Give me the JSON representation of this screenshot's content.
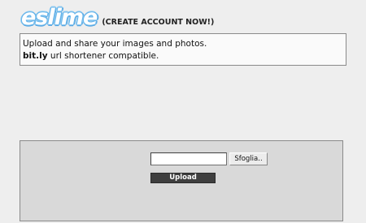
{
  "header": {
    "logo_text": "eslime",
    "cta_label": "(CREATE ACCOUNT NOW!)"
  },
  "info": {
    "line1": "Upload and share your images and photos.",
    "line2_bold": "bit.ly",
    "line2_rest": " url shortener compatible."
  },
  "upload": {
    "file_value": "",
    "browse_label": "Sfoglia..",
    "submit_label": "Upload"
  },
  "colors": {
    "background": "#eeeeee",
    "panel": "#d9d9d9",
    "upload_button": "#3f3f3f",
    "logo_outline": "#6ab6ea"
  }
}
